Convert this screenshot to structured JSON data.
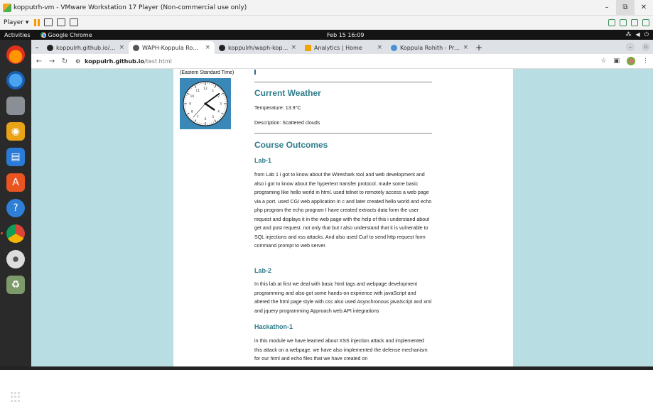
{
  "vm": {
    "title": "kopputrh-vm - VMware Workstation 17 Player (Non-commercial use only)",
    "player_menu": "Player ▾",
    "window_controls": {
      "minimize": "–",
      "maximize": "⧉",
      "close": "✕"
    }
  },
  "gnome": {
    "activities": "Activities",
    "app_name": "Google Chrome",
    "clock": "Feb 15  16:09"
  },
  "browser": {
    "tabs": [
      {
        "label": "koppulrh.github.io/proj",
        "icon_color": "#222222"
      },
      {
        "label": "WAPH-Koppula Rohithh",
        "icon_color": "#555555",
        "active": true
      },
      {
        "label": "koppulrh/waph-koppul",
        "icon_color": "#222222"
      },
      {
        "label": "Analytics | Home",
        "icon_color": "#f4a300"
      },
      {
        "label": "Koppula Rohith - Profile",
        "icon_color": "#4a90d9"
      }
    ],
    "new_tab": "+",
    "url_host": "koppulrh.github.io",
    "url_path": "/test.html"
  },
  "page": {
    "timezone_label": "(Eastern Standard Time)",
    "weather_heading": "Current Weather",
    "temperature": "Temperature: 13.9°C",
    "description": "Description: Scattered clouds",
    "outcomes_heading": "Course Outcomes",
    "lab1_heading": "Lab-1",
    "lab1_text": "from Lab 1 i got to know about the Wireshark tool and web development and also i got to know about the hypertext transfer protocol. made some basic programing like hello world in html. used telnet to remotely access a web page via a port. used CGI web application in c and later created hello world and echo php program the echo program I have created extracts data form the user request and displays it in the web page with the help of this i understand about get and post request. not only that but I also understand that it is vulnerable to SQL injections and xss attacks. And also used Curl to send http request form command prompt to web server.",
    "lab2_heading": "Lab-2",
    "lab2_text": "In this lab at first we deal with basic html tags and webpage development programming and also got some hands-on exprience with javaScript and altered the html page style with css also used Asynchronous javaScript and xml and jquery programming Approach web API integrations",
    "hack_heading": "Hackathon-1",
    "hack_text": "in this module we have learned about XSS injection attack and implemented this attack on a webpage. we have also implemented the defense mechanism for our html and echo files that we have created on"
  },
  "clock": {
    "hour": 4,
    "minute": 9,
    "second": 37,
    "face_color": "#3a88b8"
  },
  "colors": {
    "accent": "#2f7d8c",
    "page_bg": "#b8dde3",
    "dock_bg": "#2a2a2a"
  }
}
